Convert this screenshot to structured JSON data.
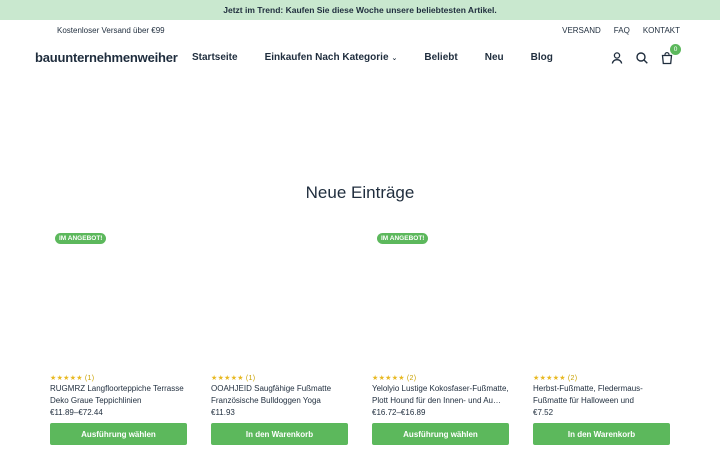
{
  "announcement": "Jetzt im Trend: Kaufen Sie diese Woche unsere beliebtesten Artikel.",
  "utility": {
    "shipping": "Kostenloser Versand über €99",
    "links": [
      "VERSAND",
      "FAQ",
      "KONTAKT"
    ]
  },
  "header": {
    "logo": "bauunternehmenweiher",
    "nav": [
      {
        "label": "Startseite"
      },
      {
        "label": "Einkaufen Nach Kategorie",
        "caret": "›"
      },
      {
        "label": "Beliebt"
      },
      {
        "label": "Neu"
      },
      {
        "label": "Blog"
      }
    ],
    "cart_count": "0",
    "icons": [
      "user-icon",
      "search-icon",
      "cart-icon"
    ]
  },
  "section_title": "Neue Einträge",
  "products": [
    {
      "badge": "IM ANGEBOT!",
      "stars": "★★★★★",
      "reviews": "(1)",
      "title": "RUGMRZ Langfloorteppiche Terrasse Deko Graue Teppichlinien schmücke…",
      "price": "€11.89–€72.44",
      "button": "Ausführung wählen"
    },
    {
      "badge": "",
      "stars": "★★★★★",
      "reviews": "(1)",
      "title": "OOAHJEID Saugfähige Fußmatte Französische Bulldoggen Yoga Rutschfe…",
      "price": "€11.93",
      "button": "In den Warenkorb"
    },
    {
      "badge": "IM ANGEBOT!",
      "stars": "★★★★★",
      "reviews": "(2)",
      "title": "Yelolyio Lustige Kokosfaser-Fußmatte, Plott Hound für den Innen- und Au…",
      "price": "€16.72–€16.89",
      "button": "Ausführung wählen"
    },
    {
      "badge": "",
      "stars": "★★★★★",
      "reviews": "(2)",
      "title": "Herbst-Fußmatte, Fledermaus-Fußmatte für Halloween und Herbstdekorat…",
      "price": "€7.52",
      "button": "In den Warenkorb"
    }
  ],
  "colors": {
    "announce_bg": "#c9e8cf",
    "accent_green": "#5cb85c",
    "text_dark": "#1f2d3d",
    "star_gold": "#e8b923"
  }
}
